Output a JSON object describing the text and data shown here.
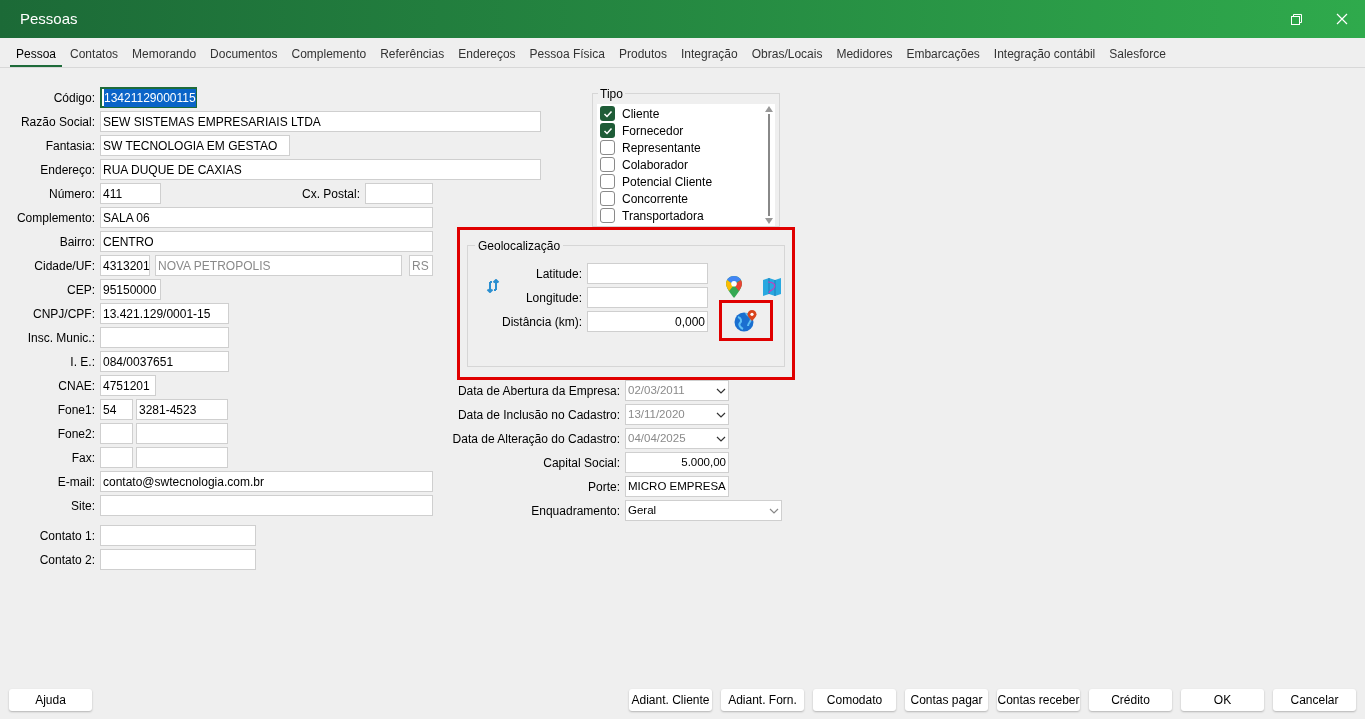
{
  "window": {
    "title": "Pessoas"
  },
  "tabs": [
    {
      "label": "Pessoa",
      "selected": true
    },
    {
      "label": "Contatos",
      "selected": false
    },
    {
      "label": "Memorando",
      "selected": false
    },
    {
      "label": "Documentos",
      "selected": false
    },
    {
      "label": "Complemento",
      "selected": false
    },
    {
      "label": "Referências",
      "selected": false
    },
    {
      "label": "Endereços",
      "selected": false
    },
    {
      "label": "Pessoa Física",
      "selected": false
    },
    {
      "label": "Produtos",
      "selected": false
    },
    {
      "label": "Integração",
      "selected": false
    },
    {
      "label": "Obras/Locais",
      "selected": false
    },
    {
      "label": "Medidores",
      "selected": false
    },
    {
      "label": "Embarcações",
      "selected": false
    },
    {
      "label": "Integração contábil",
      "selected": false
    },
    {
      "label": "Salesforce",
      "selected": false
    }
  ],
  "fields": [
    {
      "label": "Código:",
      "inputs": [
        {
          "value": "13421129000115",
          "focused": true
        }
      ]
    },
    {
      "label": "Razão Social:",
      "inputs": [
        {
          "value": "SEW SISTEMAS EMPRESARIAIS LTDA",
          "disabled": false
        }
      ]
    },
    {
      "label": "Fantasia:",
      "inputs": [
        {
          "value": "SW TECNOLOGIA EM GESTAO",
          "disabled": false
        }
      ]
    },
    {
      "label": "Endereço:",
      "inputs": [
        {
          "value": "RUA DUQUE DE CAXIAS",
          "disabled": false
        }
      ]
    },
    {
      "label": "Número:",
      "inputs": [
        {
          "value": "411",
          "disabled": false
        }
      ],
      "side": {
        "label": "Cx. Postal:"
      }
    },
    {
      "label": "Complemento:",
      "inputs": [
        {
          "value": "SALA 06",
          "disabled": false
        }
      ]
    },
    {
      "label": "Bairro:",
      "inputs": [
        {
          "value": "CENTRO",
          "disabled": false
        }
      ]
    },
    {
      "label": "Cidade/UF:",
      "inputs": [
        {
          "value": "4313201",
          "disabled": false
        },
        {
          "value": "NOVA PETROPOLIS",
          "disabled": true
        },
        {
          "value": "RS",
          "disabled": true
        }
      ]
    },
    {
      "label": "CEP:",
      "inputs": [
        {
          "value": "95150000",
          "disabled": false
        }
      ]
    },
    {
      "label": "CNPJ/CPF:",
      "inputs": [
        {
          "value": "13.421.129/0001-15",
          "disabled": false
        }
      ]
    },
    {
      "label": "Insc. Munic.:"
    },
    {
      "label": "I. E.:",
      "inputs": [
        {
          "value": "084/0037651",
          "disabled": false
        }
      ]
    },
    {
      "label": "CNAE:",
      "inputs": [
        {
          "value": "4751201",
          "disabled": false
        }
      ]
    },
    {
      "label": "Fone1:",
      "inputs": [
        {
          "value": "54",
          "disabled": false
        },
        {
          "value": "3281-4523",
          "disabled": false
        }
      ]
    },
    {
      "label": "Fone2:"
    },
    {
      "label": "Fax:"
    },
    {
      "label": "E-mail:",
      "inputs": [
        {
          "value": "contato@swtecnologia.com.br",
          "disabled": false
        }
      ]
    },
    {
      "label": "Site:"
    },
    {
      "label": "Contato 1:"
    },
    {
      "label": "Contato 2:"
    }
  ],
  "tipo": {
    "title": "Tipo",
    "items": [
      {
        "label": "Cliente",
        "checked": true
      },
      {
        "label": "Fornecedor",
        "checked": true
      },
      {
        "label": "Representante",
        "checked": false
      },
      {
        "label": "Colaborador",
        "checked": false
      },
      {
        "label": "Potencial Cliente",
        "checked": false
      },
      {
        "label": "Concorrente",
        "checked": false
      },
      {
        "label": "Transportadora",
        "checked": false
      }
    ]
  },
  "geolocation": {
    "title": "Geolocalização",
    "highlighted": true,
    "fields": [
      {
        "label": "Latitude:"
      },
      {
        "label": "Longitude:"
      },
      {
        "label": "Distância (km):",
        "value": "0,000"
      }
    ],
    "globe_button": {
      "highlighted": true
    }
  },
  "company": [
    {
      "label": "Data de Abertura da Empresa:",
      "value": "02/03/2011",
      "kind": "date",
      "disabled": true
    },
    {
      "label": "Data de Inclusão no Cadastro:",
      "value": "13/11/2020",
      "kind": "date",
      "disabled": true
    },
    {
      "label": "Data de Alteração do Cadastro:",
      "value": "04/04/2025",
      "kind": "date",
      "disabled": true
    },
    {
      "label": "Capital Social:",
      "value": "5.000,00",
      "kind": "number",
      "disabled": false
    },
    {
      "label": "Porte:",
      "value": "MICRO EMPRESA",
      "kind": "text",
      "disabled": false
    },
    {
      "label": "Enquadramento:",
      "value": "Geral",
      "kind": "select",
      "disabled": false
    }
  ],
  "footer": {
    "left": [
      {
        "label": "Ajuda"
      }
    ],
    "right": [
      {
        "label": "Adiant. Cliente"
      },
      {
        "label": "Adiant. Forn."
      },
      {
        "label": "Comodato"
      },
      {
        "label": "Contas pagar"
      },
      {
        "label": "Contas receber"
      },
      {
        "label": "Crédito"
      },
      {
        "label": "OK"
      },
      {
        "label": "Cancelar"
      }
    ]
  }
}
